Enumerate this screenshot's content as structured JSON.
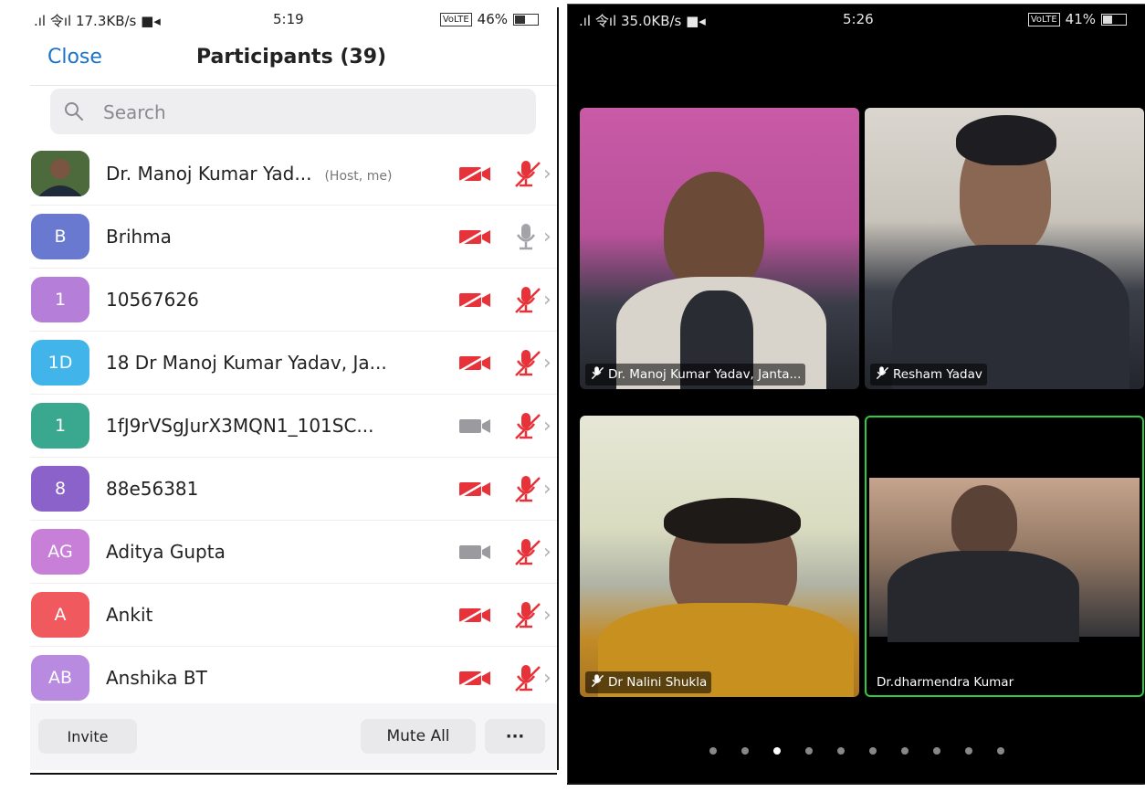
{
  "left": {
    "status": {
      "network": ".ıl 令ıl 17.3KB/s ■◂",
      "time": "5:19",
      "volte": "VoLTE",
      "battery_text": "46%",
      "battery_level": 0.46
    },
    "header": {
      "close_label": "Close",
      "title": "Participants (39)"
    },
    "search": {
      "placeholder": "Search"
    },
    "participants": [
      {
        "avatar": "",
        "avatar_color": "#3d5a33",
        "name": "Dr. Manoj Kumar Yad...",
        "tag": "(Host, me)",
        "video_icon": "video-off-icon",
        "mic_icon": "mic-muted-icon"
      },
      {
        "avatar": "B",
        "avatar_color": "#6979cf",
        "name": "Brihma",
        "tag": "",
        "video_icon": "video-off-icon",
        "mic_icon": "mic-on-icon"
      },
      {
        "avatar": "1",
        "avatar_color": "#b57ed8",
        "name": "10567626",
        "tag": "",
        "video_icon": "video-off-icon",
        "mic_icon": "mic-muted-icon"
      },
      {
        "avatar": "1D",
        "avatar_color": "#41b4ea",
        "name": "18 Dr Manoj Kumar Yadav, Ja...",
        "tag": "",
        "video_icon": "video-off-icon",
        "mic_icon": "mic-muted-icon"
      },
      {
        "avatar": "1",
        "avatar_color": "#3aa88e",
        "name": "1fJ9rVSgJurX3MQN1_101SC...",
        "tag": "",
        "video_icon": "video-on-icon",
        "mic_icon": "mic-muted-icon"
      },
      {
        "avatar": "8",
        "avatar_color": "#8a62c9",
        "name": "88e56381",
        "tag": "",
        "video_icon": "video-off-icon",
        "mic_icon": "mic-muted-icon"
      },
      {
        "avatar": "AG",
        "avatar_color": "#c77fd8",
        "name": "Aditya Gupta",
        "tag": "",
        "video_icon": "video-on-icon",
        "mic_icon": "mic-muted-icon"
      },
      {
        "avatar": "A",
        "avatar_color": "#f05a5e",
        "name": "Ankit",
        "tag": "",
        "video_icon": "video-off-icon",
        "mic_icon": "mic-muted-icon"
      },
      {
        "avatar": "AB",
        "avatar_color": "#b98be0",
        "name": "Anshika BT",
        "tag": "",
        "video_icon": "video-off-icon",
        "mic_icon": "mic-muted-icon"
      }
    ],
    "bottom": {
      "invite_label": "Invite",
      "mute_all_label": "Mute All",
      "more_label": "···"
    }
  },
  "right": {
    "status": {
      "network": ".ıl 令ıl 35.0KB/s ■◂",
      "time": "5:26",
      "volte": "VoLTE",
      "battery_text": "41%",
      "battery_level": 0.41
    },
    "tiles": [
      {
        "name": "Dr. Manoj Kumar Yadav, Janta...",
        "muted": true
      },
      {
        "name": "Resham Yadav",
        "muted": true
      },
      {
        "name": "Dr Nalini Shukla",
        "muted": true
      },
      {
        "name": "Dr.dharmendra Kumar",
        "muted": false,
        "active_speaker": true
      }
    ],
    "pages": {
      "count": 10,
      "current": 3
    }
  },
  "colors": {
    "accent": "#1a73c9",
    "muted_red": "#e8323a",
    "active_speaker": "#2ecc40"
  }
}
